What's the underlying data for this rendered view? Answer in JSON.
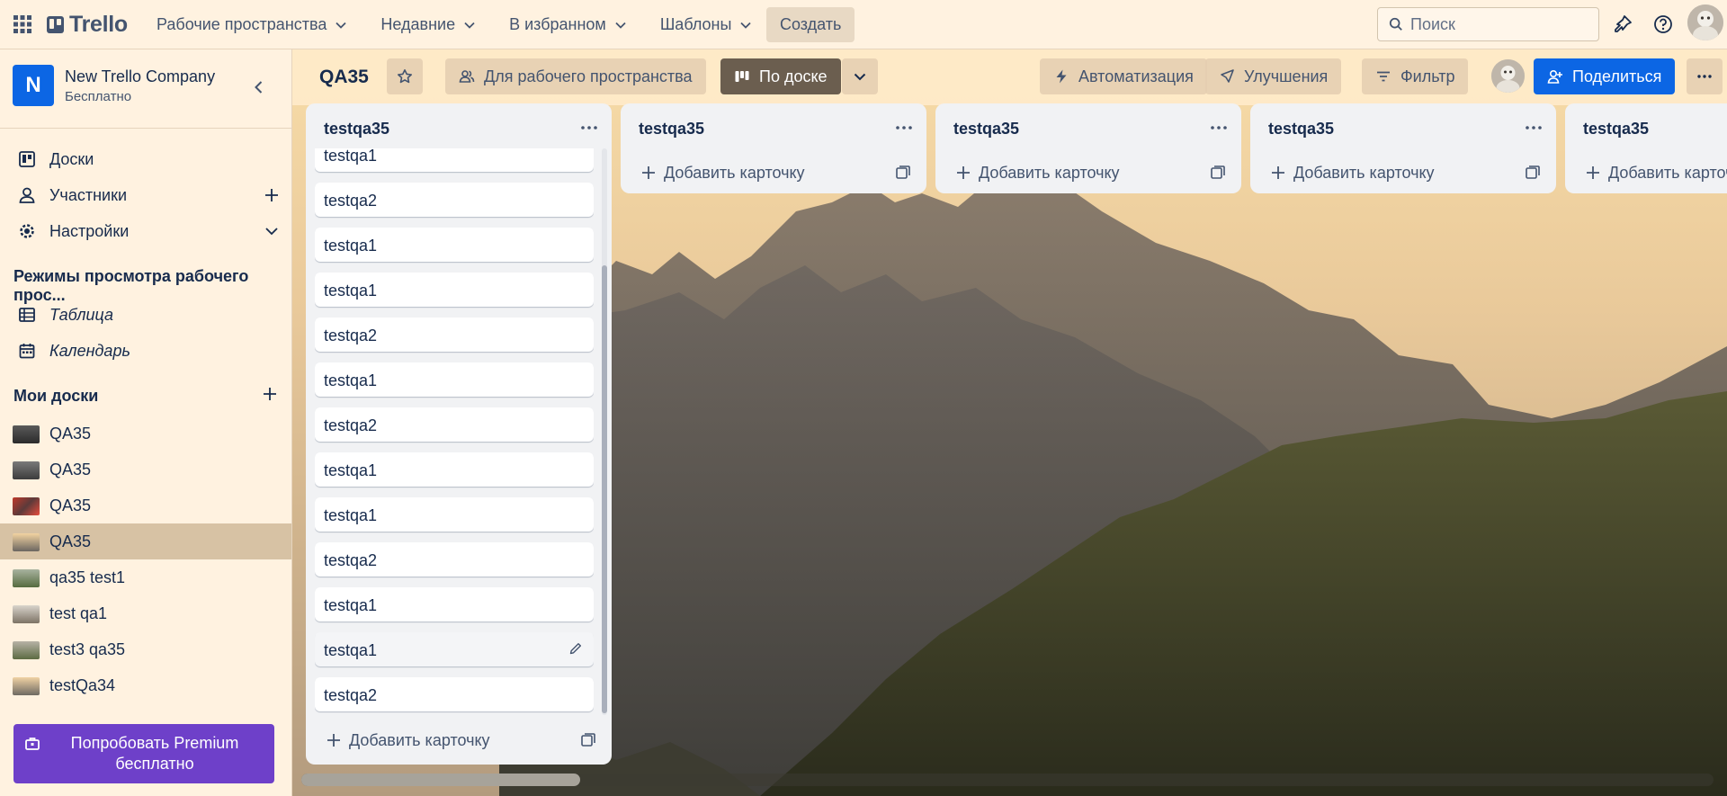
{
  "header": {
    "logo_text": "Trello",
    "nav": [
      {
        "label": "Рабочие пространства"
      },
      {
        "label": "Недавние"
      },
      {
        "label": "В избранном"
      },
      {
        "label": "Шаблоны"
      }
    ],
    "create_label": "Создать",
    "search_placeholder": "Поиск"
  },
  "sidebar": {
    "workspace_initial": "N",
    "workspace_name": "New Trello Company",
    "workspace_plan": "Бесплатно",
    "items": [
      {
        "label": "Доски",
        "icon": "board-icon"
      },
      {
        "label": "Участники",
        "icon": "person-icon"
      },
      {
        "label": "Настройки",
        "icon": "gear-icon"
      }
    ],
    "views_heading": "Режимы просмотра рабочего прос...",
    "views": [
      {
        "label": "Таблица",
        "icon": "table-icon"
      },
      {
        "label": "Календарь",
        "icon": "calendar-icon"
      }
    ],
    "my_boards_heading": "Мои доски",
    "boards": [
      {
        "label": "QA35",
        "active": false
      },
      {
        "label": "QA35",
        "active": false
      },
      {
        "label": "QA35",
        "active": false
      },
      {
        "label": "QA35",
        "active": true
      },
      {
        "label": "qa35 test1",
        "active": false
      },
      {
        "label": "test qa1",
        "active": false
      },
      {
        "label": "test3 qa35",
        "active": false
      },
      {
        "label": "testQa34",
        "active": false
      }
    ],
    "premium_label": "Попробовать Premium бесплатно"
  },
  "board": {
    "title": "QA35",
    "visibility_label": "Для рабочего пространства",
    "view_label": "По доске",
    "automation_label": "Автоматизация",
    "powerups_label": "Улучшения",
    "filter_label": "Фильтр",
    "share_label": "Поделиться",
    "add_card_label": "Добавить карточку",
    "lists": [
      {
        "title": "testqa35",
        "cards": [
          "testqa1",
          "testqa2",
          "testqa1",
          "testqa1",
          "testqa2",
          "testqa1",
          "testqa2",
          "testqa1",
          "testqa1",
          "testqa2",
          "testqa1",
          "testqa1",
          "testqa2"
        ]
      },
      {
        "title": "testqa35",
        "cards": []
      },
      {
        "title": "testqa35",
        "cards": []
      },
      {
        "title": "testqa35",
        "cards": []
      },
      {
        "title": "testqa35",
        "cards": []
      }
    ]
  },
  "colors": {
    "header_bg": "#fff2e0",
    "accent": "#0c66e4",
    "premium": "#6e40c9"
  }
}
